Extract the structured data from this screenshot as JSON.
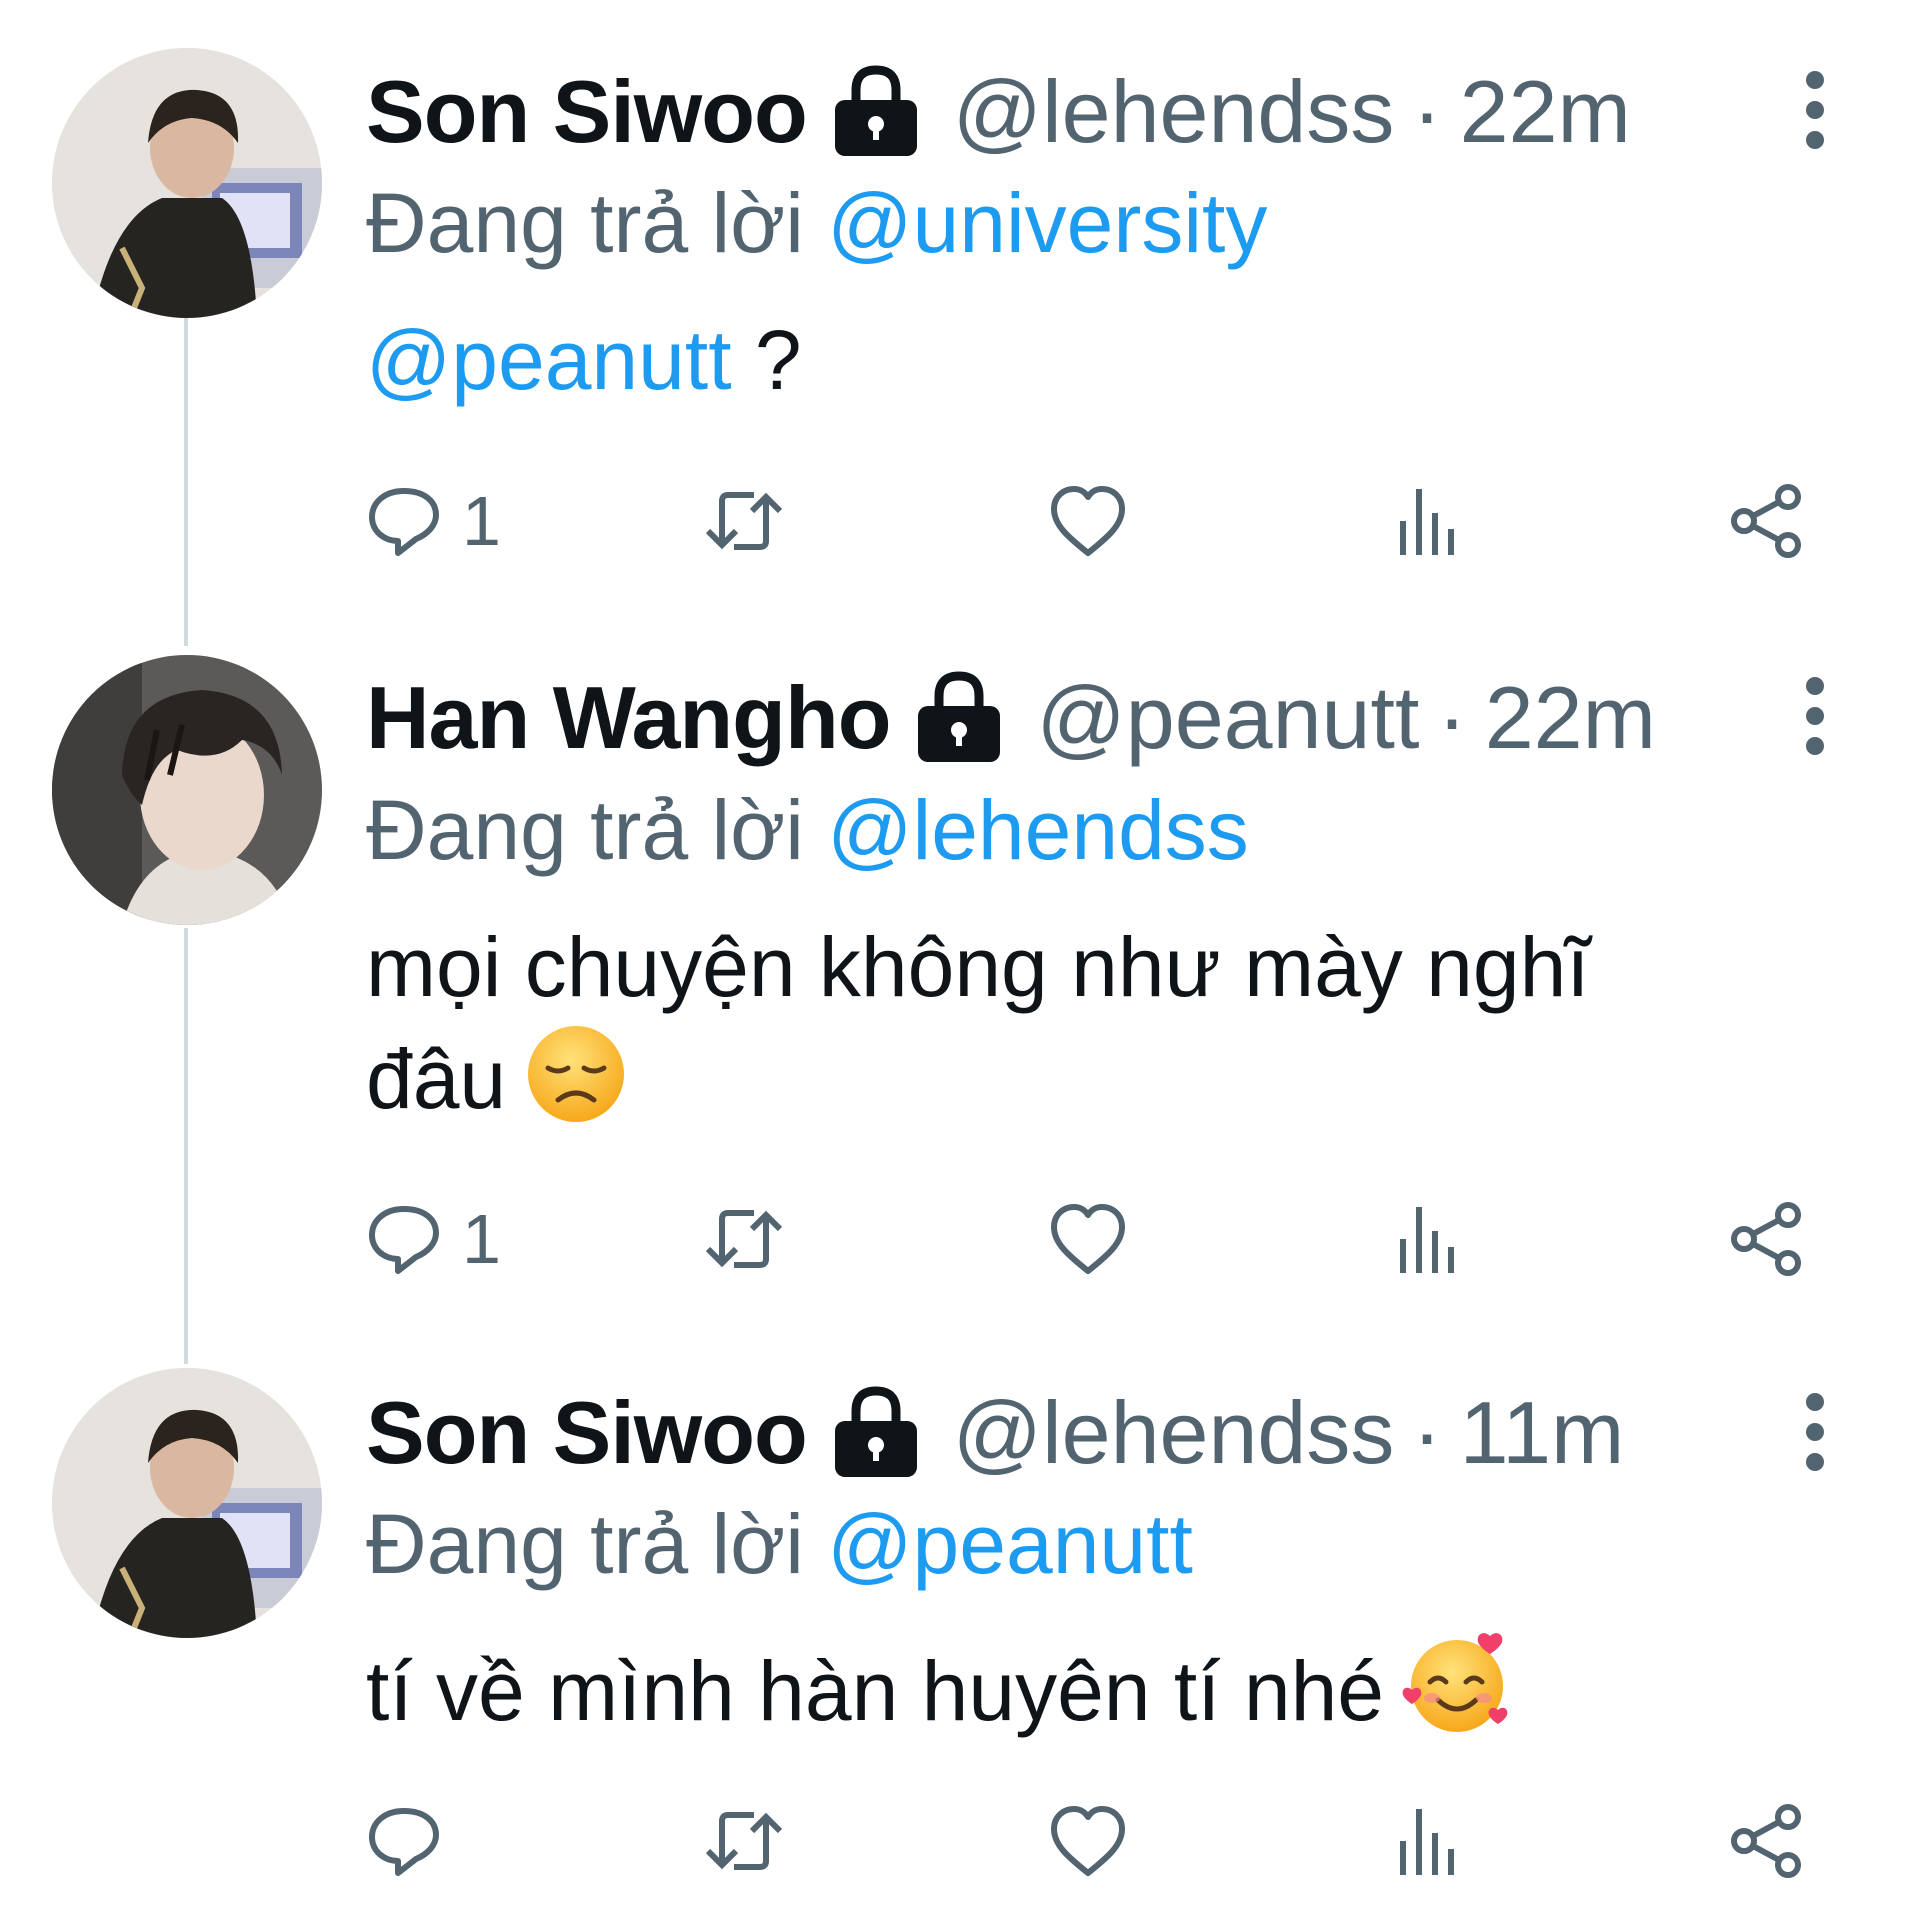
{
  "tweets": [
    {
      "display_name": "Son Siwoo",
      "handle": "@lehendss",
      "separator": "·",
      "time": "22m",
      "reply_prefix": "Đang trả lời",
      "reply_to": "@university",
      "body_mention": "@peanutt",
      "body_text": " ?",
      "reply_count": "1",
      "icons": {
        "lock": "lock-icon",
        "more": "more-vertical-icon",
        "reply": "reply-icon",
        "retweet": "retweet-icon",
        "like": "heart-icon",
        "views": "views-icon",
        "share": "share-icon"
      }
    },
    {
      "display_name": "Han Wangho",
      "handle": "@peanutt",
      "separator": "·",
      "time": "22m",
      "reply_prefix": "Đang trả lời",
      "reply_to": "@lehendss",
      "body_line1": "mọi chuyện không như mày nghĩ",
      "body_line2": "đâu",
      "body_emoji": "disappointed-face-emoji",
      "reply_count": "1"
    },
    {
      "display_name": "Son Siwoo",
      "handle": "@lehendss",
      "separator": "·",
      "time": "11m",
      "reply_prefix": "Đang trả lời",
      "reply_to": "@peanutt",
      "body_text": "tí về mình hàn huyên tí nhé",
      "body_emoji": "smiling-face-with-hearts-emoji",
      "reply_count": ""
    }
  ],
  "colors": {
    "text": "#0f1419",
    "secondary": "#536471",
    "link": "#1d9bf0",
    "thread_line": "#cfd9de"
  }
}
